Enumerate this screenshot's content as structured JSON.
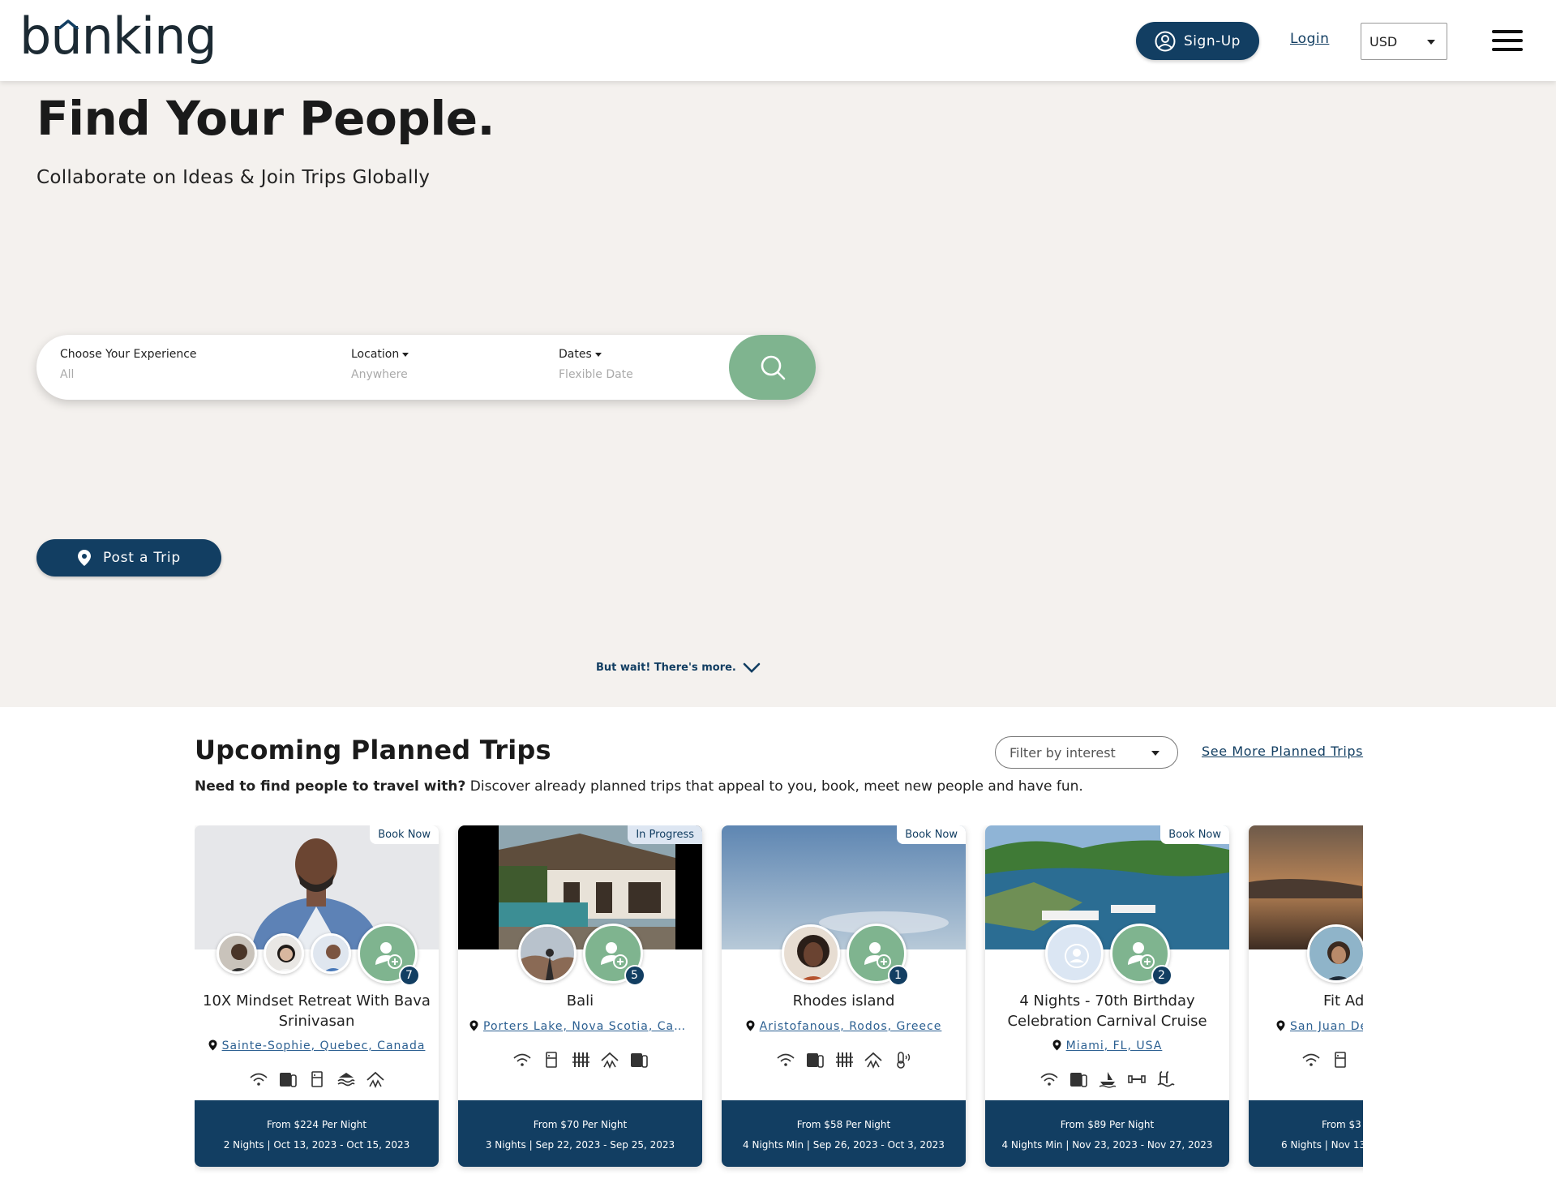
{
  "header": {
    "logo": "bunking",
    "signup_label": "Sign-Up",
    "login_label": "Login",
    "currency": "USD"
  },
  "hero": {
    "title": "Find Your People.",
    "subtitle": "Collaborate on Ideas & Join Trips Globally",
    "search": {
      "experience_label": "Choose Your Experience",
      "experience_value": "All",
      "location_label": "Location",
      "location_value": "Anywhere",
      "dates_label": "Dates",
      "dates_value": "Flexible Date"
    },
    "post_trip_label": "Post a Trip",
    "more_label": "But wait! There's more."
  },
  "trips": {
    "title": "Upcoming Planned Trips",
    "filter_placeholder": "Filter by interest",
    "see_more_label": "See More Planned Trips",
    "desc_bold": "Need to find people to travel with?",
    "desc_rest": " Discover already planned trips that appeal to you, book, meet new people and have fun.",
    "cards": [
      {
        "badge": "Book Now",
        "title": "10X Mindset Retreat With Bava Srinivasan",
        "location": "Sainte-Sophie, Quebec, Canada",
        "count": "7",
        "price": "From $224 Per Night",
        "dates": "2 Nights | Oct 13, 2023 - Oct 15, 2023"
      },
      {
        "badge": "In Progress",
        "title": "Bali",
        "location": "Porters Lake, Nova Scotia, Can…",
        "count": "5",
        "price": "From $70 Per Night",
        "dates": "3 Nights | Sep 22, 2023 - Sep 25, 2023"
      },
      {
        "badge": "Book Now",
        "title": "Rhodes island",
        "location": "Aristofanous, Rodos, Greece",
        "count": "1",
        "price": "From $58 Per Night",
        "dates": "4 Nights Min | Sep 26, 2023 - Oct 3, 2023"
      },
      {
        "badge": "Book Now",
        "title": "4 Nights - 70th Birthday Celebration Carnival Cruise",
        "location": "Miami, FL, USA",
        "count": "2",
        "price": "From $89 Per Night",
        "dates": "4 Nights Min | Nov 23, 2023 - Nov 27, 2023"
      },
      {
        "badge": "",
        "title": "Fit Ad",
        "location": "San Juan De",
        "count": "",
        "price": "From $3",
        "dates": "6 Nights | Nov 13"
      }
    ]
  },
  "colors": {
    "navy": "#123e62",
    "green": "#7fb48f",
    "hero_bg": "#f4f1ee"
  },
  "icons": [
    "user-circle-icon",
    "search-icon",
    "map-pin-icon",
    "chevron-down-icon",
    "menu-icon",
    "wifi-icon",
    "fridge-icon",
    "washer-icon",
    "pool-icon",
    "gym-icon"
  ]
}
